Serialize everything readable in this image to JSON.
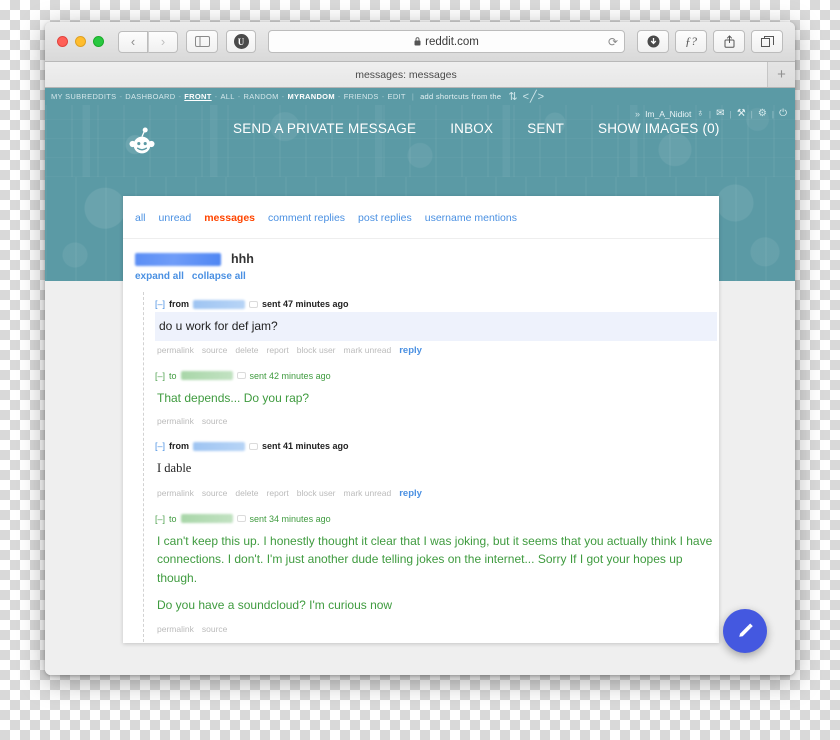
{
  "browser": {
    "traffic_lights": [
      "close",
      "minimize",
      "zoom"
    ],
    "back_label": "‹",
    "forward_label": "›",
    "sidebar_label": "sidebar",
    "extension_label": "U",
    "url": "reddit.com",
    "lock_label": "🔒",
    "reload_label": "⟳",
    "download_label": "download",
    "reader_label": "ƒ?",
    "share_label": "share",
    "tabs_overview_label": "tabs",
    "tab_title": "messages: messages",
    "new_tab_label": "+"
  },
  "reddit_topnav": {
    "items": [
      {
        "label": "MY SUBREDDITS",
        "style": "normal"
      },
      {
        "label": "DASHBOARD",
        "style": "normal"
      },
      {
        "label": "FRONT",
        "style": "front"
      },
      {
        "label": "ALL",
        "style": "normal"
      },
      {
        "label": "RANDOM",
        "style": "normal"
      },
      {
        "label": "MYRANDOM",
        "style": "bold"
      },
      {
        "label": "FRIENDS",
        "style": "normal"
      },
      {
        "label": "EDIT",
        "style": "normal"
      }
    ],
    "separator": "-",
    "pipe": "|",
    "shortcut_text": "add shortcuts from the",
    "glyphs": "⇅ <╱>"
  },
  "userbar": {
    "chevron": "»",
    "username": "Im_A_Nidiot",
    "trophy_icon": "♁",
    "mail_icon": "✉",
    "tools_icon": "⚒",
    "gear_icon": "⚙",
    "power_icon": "⏻",
    "divider": "|"
  },
  "reddit_header": {
    "logo": "snoo-logo",
    "nav": [
      {
        "label": "SEND A PRIVATE MESSAGE",
        "name": "nav-send-private-message"
      },
      {
        "label": "INBOX",
        "name": "nav-inbox"
      },
      {
        "label": "SENT",
        "name": "nav-sent"
      },
      {
        "label": "SHOW IMAGES (0)",
        "name": "nav-show-images"
      }
    ]
  },
  "message_tabs": [
    {
      "label": "all",
      "active": false
    },
    {
      "label": "unread",
      "active": false
    },
    {
      "label": "messages",
      "active": true
    },
    {
      "label": "comment replies",
      "active": false
    },
    {
      "label": "post replies",
      "active": false
    },
    {
      "label": "username mentions",
      "active": false
    }
  ],
  "thread": {
    "author_redacted": true,
    "subject": "hhh",
    "expand_all": "expand all",
    "collapse_all": "collapse all"
  },
  "messages": [
    {
      "collapse": "[–]",
      "direction": "from",
      "user_redacted": true,
      "sent": "sent 47 minutes ago",
      "body": [
        "do u work for def jam?"
      ],
      "unread": true,
      "outgoing": false,
      "serif": false,
      "actions": [
        "permalink",
        "source",
        "delete",
        "report",
        "block user",
        "mark unread"
      ],
      "reply": "reply"
    },
    {
      "collapse": "[–]",
      "direction": "to",
      "user_redacted": true,
      "sent": "sent 42 minutes ago",
      "body": [
        "That depends... Do you rap?"
      ],
      "unread": false,
      "outgoing": true,
      "serif": false,
      "actions": [
        "permalink",
        "source"
      ],
      "reply": ""
    },
    {
      "collapse": "[–]",
      "direction": "from",
      "user_redacted": true,
      "sent": "sent 41 minutes ago",
      "body": [
        "I dable"
      ],
      "unread": false,
      "outgoing": false,
      "serif": true,
      "actions": [
        "permalink",
        "source",
        "delete",
        "report",
        "block user",
        "mark unread"
      ],
      "reply": "reply"
    },
    {
      "collapse": "[–]",
      "direction": "to",
      "user_redacted": true,
      "sent": "sent 34 minutes ago",
      "body": [
        "I can't keep this up. I honestly thought it clear that I was joking, but it seems that you actually think I have connections. I don't. I'm just another dude telling jokes on the internet... Sorry If I got your hopes up though.",
        "Do you have a soundcloud? I'm curious now"
      ],
      "unread": false,
      "outgoing": true,
      "serif": false,
      "actions": [
        "permalink",
        "source"
      ],
      "reply": ""
    }
  ],
  "fab": {
    "icon": "pencil-icon"
  },
  "colors": {
    "reddit_teal": "#5b9aa5",
    "accent_orange": "#ff4500",
    "link_blue": "#4a90e2",
    "outgoing_green": "#3f9b3f",
    "unread_bg": "#eef2fc",
    "fab_blue": "#4458e0"
  }
}
